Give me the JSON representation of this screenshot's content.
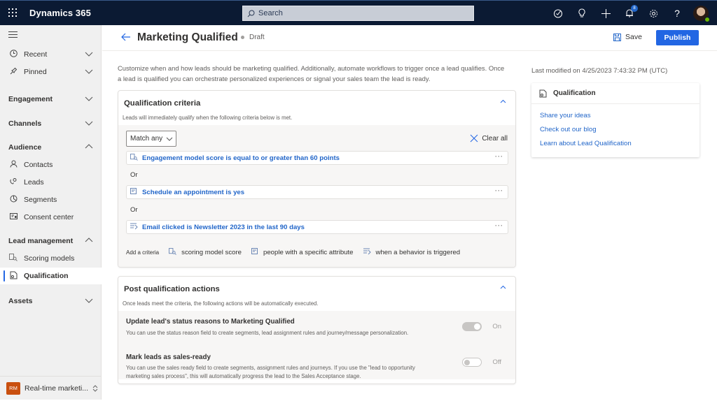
{
  "topbar": {
    "app_title": "Dynamics 365",
    "search_placeholder": "Search",
    "notification_count": "8",
    "icons": [
      "waffle-icon",
      "copilot-icon",
      "lightbulb-icon",
      "plus-icon",
      "bell-icon",
      "gear-icon",
      "help-icon",
      "avatar"
    ]
  },
  "sidebar": {
    "items": [
      {
        "label": "Recent",
        "icon": "clock-icon"
      },
      {
        "label": "Pinned",
        "icon": "pin-icon"
      }
    ],
    "groups": {
      "engagement": "Engagement",
      "channels": "Channels",
      "audience": "Audience",
      "lead_management": "Lead management",
      "assets": "Assets"
    },
    "audience_items": [
      {
        "label": "Contacts",
        "icon": "person-icon"
      },
      {
        "label": "Leads",
        "icon": "leads-icon"
      },
      {
        "label": "Segments",
        "icon": "segments-icon"
      },
      {
        "label": "Consent center",
        "icon": "consent-icon"
      }
    ],
    "lead_items": [
      {
        "label": "Scoring models",
        "icon": "scoring-icon"
      },
      {
        "label": "Qualification",
        "icon": "qualification-icon",
        "active": true
      }
    ],
    "area": {
      "badge": "RM",
      "label": "Real-time marketi..."
    }
  },
  "header": {
    "title": "Marketing Qualified",
    "status": "Draft",
    "save_label": "Save",
    "publish_label": "Publish"
  },
  "main": {
    "description": "Customize when and how leads should be marketing qualified. Additionally, automate workflows to trigger once a lead qualifies. Once a lead is qualified you can orchestrate personalized experiences or signal your sales team the lead is ready.",
    "last_modified": "Last modified on 4/25/2023 7:43:32 PM (UTC)",
    "criteria": {
      "title": "Qualification criteria",
      "subtitle": "Leads will immediately qualify when the following criteria below is met.",
      "match_value": "Match any",
      "clear_all": "Clear all",
      "or_label": "Or",
      "items": [
        {
          "text": "Engagement model score is equal to or greater than 60 points",
          "icon": "scoring-icon"
        },
        {
          "text": "Schedule an appointment is yes",
          "icon": "attribute-icon"
        },
        {
          "text": "Email clicked is Newsletter 2023 in the last 90 days",
          "icon": "behavior-icon"
        }
      ],
      "add_label": "Add a criteria",
      "add_options": [
        {
          "label": "scoring model score",
          "icon": "scoring-icon"
        },
        {
          "label": "people with a specific attribute",
          "icon": "attribute-icon"
        },
        {
          "label": "when a behavior is triggered",
          "icon": "behavior-icon"
        }
      ]
    },
    "post_actions": {
      "title": "Post qualification actions",
      "subtitle": "Once leads meet the criteria, the following actions will be automatically executed.",
      "actions": [
        {
          "title": "Update lead's status reasons to Marketing Qualified",
          "desc": "You can use the status reason field to create segments, lead assignment rules and journey/message personalization.",
          "toggle": "On"
        },
        {
          "title": "Mark leads as sales-ready",
          "desc": "You can use the sales ready field to create segments, assignment rules and journeys. If you use the \"lead to opportunity marketing sales process\", this will automatically progress the lead to the Sales Acceptance stage.",
          "toggle": "Off"
        }
      ]
    }
  },
  "side_panel": {
    "title": "Qualification",
    "links": [
      "Share your ideas",
      "Check out our blog",
      "Learn about Lead Qualification"
    ]
  }
}
